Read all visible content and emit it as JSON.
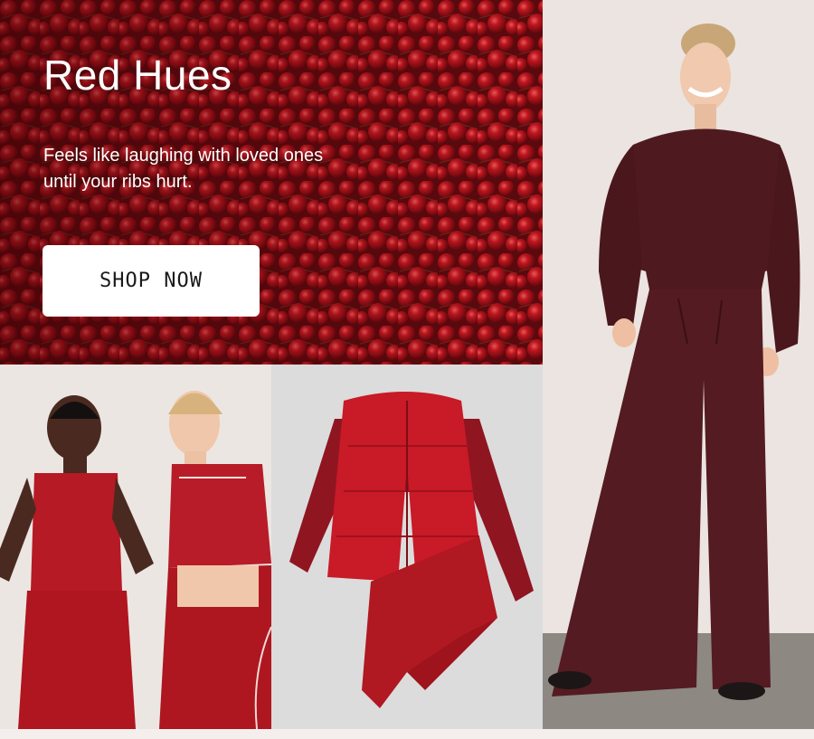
{
  "hero": {
    "title": "Red Hues",
    "subtitle": "Feels like laughing with loved ones until your ribs hurt.",
    "cta_label": "SHOP NOW"
  },
  "images": {
    "hero_background": "red-berries-photo",
    "women": "two-women-red-activewear-photo",
    "flatlay": "red-puffer-vest-flatlay-photo",
    "model": "woman-burgundy-sweatshirt-wide-pants-photo"
  },
  "colors": {
    "berry_red": "#b3121c",
    "burgundy": "#4e1a20",
    "cta_background": "#ffffff",
    "cta_text": "#1a1a1a"
  }
}
